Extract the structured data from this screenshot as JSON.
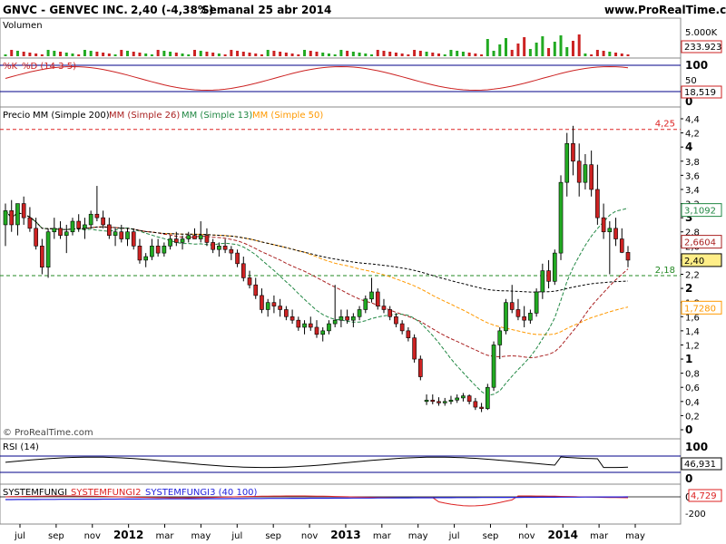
{
  "header": {
    "ticker": "GNVC - GENVEC INC.",
    "quote": "2,40 (-4,38%)",
    "period": "Semanal  25 abr 2014",
    "site": "www.ProRealTime.com"
  },
  "colors": {
    "up": "#22aa22",
    "down": "#cc2222",
    "sma200": "#000000",
    "sma26": "#aa2222",
    "sma13": "#228844",
    "sma50": "#ff9900",
    "resistance": "#dd2222",
    "support": "#228822",
    "rsi_band": "#000088",
    "fungi1": "#000000",
    "fungi2": "#dd2222",
    "fungi3": "#2222dd"
  },
  "chart_data": [
    {
      "panel": "volume",
      "type": "bar",
      "title": "Volumen",
      "yticks": [
        "5.000K"
      ],
      "last_value": "233.923"
    },
    {
      "panel": "stochastic",
      "type": "line",
      "legend": [
        "%K",
        "%D (14 3 5)"
      ],
      "yticks": [
        "100",
        "50",
        "0"
      ],
      "last_value": "18,519"
    },
    {
      "panel": "price",
      "type": "candlestick",
      "title": "Precio",
      "legend": [
        "MM (Simple 200)",
        "MM (Simple 26)",
        "MM (Simple 13)",
        "MM (Simple 50)"
      ],
      "ylim": [
        0,
        4.4
      ],
      "yticks": [
        "4,4",
        "4,2",
        "4",
        "3,8",
        "3,6",
        "3,4",
        "3,2",
        "3",
        "2,8",
        "2,6",
        "2,4",
        "2,2",
        "2",
        "1,8",
        "1,6",
        "1,4",
        "1,2",
        "1",
        "0,8",
        "0,6",
        "0,4",
        "0,2",
        "0"
      ],
      "hlines": [
        {
          "value": 4.25,
          "label": "4,25"
        },
        {
          "value": 2.18,
          "label": "2,18"
        }
      ],
      "value_tags": [
        {
          "value": 3.1092,
          "label": "3,1092"
        },
        {
          "value": 2.6604,
          "label": "2,6604"
        },
        {
          "value": 2.4,
          "label": "2,40"
        },
        {
          "value": 1.728,
          "label": "1,7280"
        }
      ],
      "watermark": "© ProRealTime.com",
      "ohlc": [
        [
          2.9,
          3.2,
          2.6,
          3.1
        ],
        [
          3.1,
          3.25,
          2.8,
          2.9
        ],
        [
          2.9,
          3.15,
          2.75,
          3.2
        ],
        [
          3.2,
          3.3,
          2.9,
          3.0
        ],
        [
          3.0,
          3.15,
          2.8,
          2.85
        ],
        [
          2.85,
          3.0,
          2.55,
          2.6
        ],
        [
          2.6,
          2.7,
          2.2,
          2.3
        ],
        [
          2.3,
          2.85,
          2.15,
          2.8
        ],
        [
          2.8,
          3.0,
          2.7,
          2.85
        ],
        [
          2.85,
          2.95,
          2.7,
          2.75
        ],
        [
          2.75,
          2.9,
          2.5,
          2.8
        ],
        [
          2.8,
          3.0,
          2.75,
          2.95
        ],
        [
          2.95,
          3.05,
          2.8,
          2.85
        ],
        [
          2.85,
          3.0,
          2.7,
          2.9
        ],
        [
          2.9,
          3.1,
          2.85,
          3.05
        ],
        [
          3.05,
          3.45,
          2.95,
          3.0
        ],
        [
          3.0,
          3.1,
          2.85,
          2.9
        ],
        [
          2.9,
          3.0,
          2.7,
          2.75
        ],
        [
          2.75,
          2.85,
          2.6,
          2.8
        ],
        [
          2.8,
          2.9,
          2.65,
          2.7
        ],
        [
          2.7,
          2.85,
          2.6,
          2.8
        ],
        [
          2.8,
          2.85,
          2.55,
          2.6
        ],
        [
          2.6,
          2.7,
          2.35,
          2.4
        ],
        [
          2.4,
          2.5,
          2.3,
          2.45
        ],
        [
          2.45,
          2.7,
          2.4,
          2.6
        ],
        [
          2.6,
          2.7,
          2.45,
          2.5
        ],
        [
          2.5,
          2.65,
          2.45,
          2.6
        ],
        [
          2.6,
          2.75,
          2.55,
          2.7
        ],
        [
          2.7,
          2.8,
          2.6,
          2.65
        ],
        [
          2.65,
          2.75,
          2.55,
          2.7
        ],
        [
          2.7,
          2.8,
          2.65,
          2.75
        ],
        [
          2.75,
          2.85,
          2.7,
          2.7
        ],
        [
          2.7,
          2.95,
          2.65,
          2.75
        ],
        [
          2.75,
          2.85,
          2.6,
          2.65
        ],
        [
          2.65,
          2.7,
          2.5,
          2.55
        ],
        [
          2.55,
          2.65,
          2.45,
          2.6
        ],
        [
          2.6,
          2.7,
          2.5,
          2.55
        ],
        [
          2.55,
          2.6,
          2.4,
          2.5
        ],
        [
          2.5,
          2.55,
          2.3,
          2.35
        ],
        [
          2.35,
          2.45,
          2.1,
          2.15
        ],
        [
          2.15,
          2.25,
          2.0,
          2.05
        ],
        [
          2.05,
          2.15,
          1.85,
          1.9
        ],
        [
          1.9,
          2.0,
          1.65,
          1.7
        ],
        [
          1.7,
          1.85,
          1.6,
          1.8
        ],
        [
          1.8,
          1.9,
          1.65,
          1.75
        ],
        [
          1.75,
          1.85,
          1.6,
          1.7
        ],
        [
          1.7,
          1.75,
          1.55,
          1.6
        ],
        [
          1.6,
          1.7,
          1.5,
          1.55
        ],
        [
          1.55,
          1.6,
          1.4,
          1.45
        ],
        [
          1.45,
          1.55,
          1.35,
          1.5
        ],
        [
          1.5,
          1.6,
          1.4,
          1.45
        ],
        [
          1.45,
          1.55,
          1.3,
          1.35
        ],
        [
          1.35,
          1.45,
          1.25,
          1.4
        ],
        [
          1.4,
          1.55,
          1.35,
          1.5
        ],
        [
          1.5,
          2.05,
          1.45,
          1.55
        ],
        [
          1.55,
          1.7,
          1.45,
          1.6
        ],
        [
          1.6,
          1.7,
          1.5,
          1.55
        ],
        [
          1.55,
          1.65,
          1.45,
          1.6
        ],
        [
          1.6,
          1.75,
          1.55,
          1.7
        ],
        [
          1.7,
          1.9,
          1.65,
          1.85
        ],
        [
          1.85,
          2.15,
          1.8,
          1.95
        ],
        [
          1.95,
          2.0,
          1.7,
          1.75
        ],
        [
          1.75,
          1.85,
          1.65,
          1.7
        ],
        [
          1.7,
          1.75,
          1.55,
          1.6
        ],
        [
          1.6,
          1.65,
          1.45,
          1.5
        ],
        [
          1.5,
          1.55,
          1.35,
          1.4
        ],
        [
          1.4,
          1.45,
          1.25,
          1.3
        ],
        [
          1.3,
          1.35,
          0.95,
          1.0
        ],
        [
          1.0,
          1.05,
          0.7,
          0.75
        ],
        [
          0.4,
          0.5,
          0.35,
          0.42
        ],
        [
          0.42,
          0.5,
          0.36,
          0.4
        ],
        [
          0.4,
          0.46,
          0.34,
          0.38
        ],
        [
          0.38,
          0.45,
          0.34,
          0.4
        ],
        [
          0.4,
          0.48,
          0.36,
          0.42
        ],
        [
          0.42,
          0.5,
          0.38,
          0.45
        ],
        [
          0.45,
          0.52,
          0.4,
          0.48
        ],
        [
          0.48,
          0.5,
          0.36,
          0.4
        ],
        [
          0.4,
          0.45,
          0.28,
          0.32
        ],
        [
          0.32,
          0.38,
          0.25,
          0.3
        ],
        [
          0.3,
          0.65,
          0.28,
          0.6
        ],
        [
          0.6,
          1.25,
          0.55,
          1.2
        ],
        [
          1.2,
          1.45,
          1.0,
          1.4
        ],
        [
          1.4,
          1.85,
          1.35,
          1.8
        ],
        [
          1.8,
          2.05,
          1.65,
          1.7
        ],
        [
          1.7,
          1.85,
          1.55,
          1.6
        ],
        [
          1.6,
          1.75,
          1.45,
          1.55
        ],
        [
          1.55,
          1.7,
          1.5,
          1.65
        ],
        [
          1.65,
          2.0,
          1.6,
          1.95
        ],
        [
          1.95,
          2.35,
          1.85,
          2.25
        ],
        [
          2.25,
          2.4,
          2.0,
          2.1
        ],
        [
          2.1,
          2.55,
          2.05,
          2.5
        ],
        [
          2.5,
          3.6,
          2.4,
          3.5
        ],
        [
          3.5,
          4.2,
          3.3,
          4.05
        ],
        [
          4.05,
          4.3,
          3.6,
          3.8
        ],
        [
          3.8,
          4.05,
          3.3,
          3.5
        ],
        [
          3.5,
          3.9,
          3.4,
          3.75
        ],
        [
          3.75,
          3.95,
          3.3,
          3.4
        ],
        [
          3.4,
          3.75,
          2.9,
          3.0
        ],
        [
          3.0,
          3.2,
          2.7,
          2.8
        ],
        [
          2.8,
          2.95,
          2.2,
          2.85
        ],
        [
          2.85,
          3.0,
          2.6,
          2.7
        ],
        [
          2.7,
          2.85,
          2.5,
          2.51
        ],
        [
          2.51,
          2.6,
          2.3,
          2.4
        ]
      ]
    },
    {
      "panel": "rsi",
      "type": "line",
      "title": "RSI (14)",
      "yticks": [
        "100",
        "0"
      ],
      "last_value": "46,931"
    },
    {
      "panel": "systemfungi",
      "type": "line",
      "legend": [
        "SYSTEMFUNGI",
        "SYSTEMFUNGI2",
        "SYSTEMFUNGI3 (40 100)"
      ],
      "yticks": [
        "0",
        "-200"
      ],
      "last_value": "4,729"
    }
  ],
  "xaxis": {
    "labels": [
      "jul",
      "sep",
      "nov",
      "2012",
      "mar",
      "may",
      "jul",
      "sep",
      "nov",
      "2013",
      "mar",
      "may",
      "jul",
      "sep",
      "nov",
      "2014",
      "mar",
      "may"
    ],
    "bold": [
      "2012",
      "2013",
      "2014"
    ]
  }
}
